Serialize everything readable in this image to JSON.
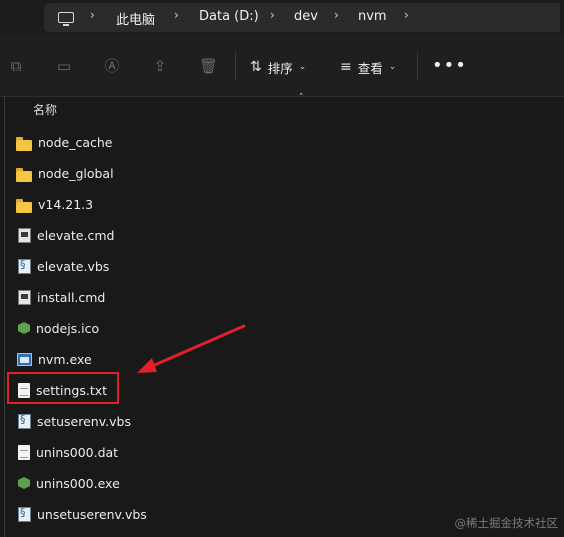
{
  "address_bar": {
    "crumbs": [
      "此电脑",
      "Data (D:)",
      "dev",
      "nvm"
    ],
    "separator": "›"
  },
  "toolbar": {
    "sort_label": "排序",
    "view_label": "查看",
    "more_label": "•••"
  },
  "file_list": {
    "column_header": "名称",
    "items": [
      {
        "name": "node_cache",
        "icon": "folder-icon"
      },
      {
        "name": "node_global",
        "icon": "folder-icon"
      },
      {
        "name": "v14.21.3",
        "icon": "folder-icon"
      },
      {
        "name": "elevate.cmd",
        "icon": "cmd-file-icon"
      },
      {
        "name": "elevate.vbs",
        "icon": "script-file-icon"
      },
      {
        "name": "install.cmd",
        "icon": "cmd-file-icon"
      },
      {
        "name": "nodejs.ico",
        "icon": "node-icon"
      },
      {
        "name": "nvm.exe",
        "icon": "exe-icon"
      },
      {
        "name": "settings.txt",
        "icon": "text-file-icon"
      },
      {
        "name": "setuserenv.vbs",
        "icon": "script-file-icon"
      },
      {
        "name": "unins000.dat",
        "icon": "text-file-icon"
      },
      {
        "name": "unins000.exe",
        "icon": "node-icon"
      },
      {
        "name": "unsetuserenv.vbs",
        "icon": "script-file-icon"
      }
    ]
  },
  "annotation": {
    "highlight_color": "#e0202a"
  },
  "watermark": "@稀土掘金技术社区"
}
